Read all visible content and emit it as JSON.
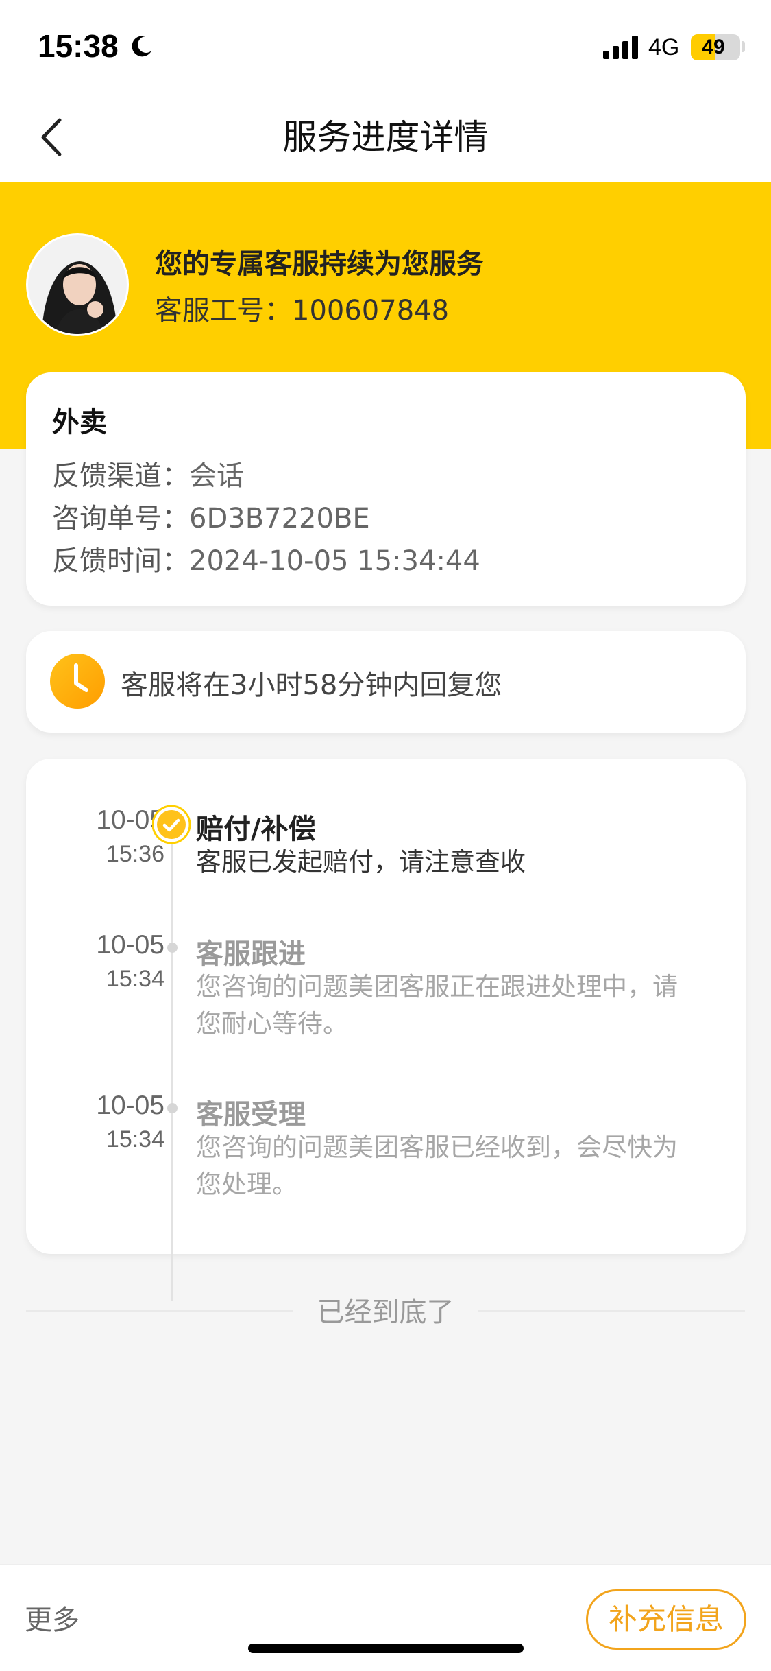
{
  "status_bar": {
    "time": "15:38",
    "network": "4G",
    "battery": "49",
    "battery_level": 0.49
  },
  "nav": {
    "title": "服务进度详情",
    "back_icon": "chevron-left-icon"
  },
  "agent": {
    "title": "您的专属客服持续为您服务",
    "id_label": "客服工号：100607848"
  },
  "info": {
    "title": "外卖",
    "rows": [
      {
        "label": "反馈渠道：",
        "value": "会话"
      },
      {
        "label": "咨询单号：",
        "value": "6D3B7220BE"
      },
      {
        "label": "反馈时间：",
        "value": "2024-10-05 15:34:44"
      }
    ]
  },
  "reply": {
    "text": "客服将在3小时58分钟内回复您",
    "icon": "clock-icon"
  },
  "timeline": [
    {
      "date": "10-05",
      "time": "15:36",
      "title": "赔付/补偿",
      "desc": "客服已发起赔付，请注意查收",
      "status": "done"
    },
    {
      "date": "10-05",
      "time": "15:34",
      "title": "客服跟进",
      "desc": "您咨询的问题美团客服正在跟进处理中，请您耐心等待。",
      "status": "past"
    },
    {
      "date": "10-05",
      "time": "15:34",
      "title": "客服受理",
      "desc": "您咨询的问题美团客服已经收到，会尽快为您处理。",
      "status": "past"
    }
  ],
  "end_text": "已经到底了",
  "bottom": {
    "more_label": "更多",
    "supplement_label": "补充信息"
  },
  "colors": {
    "brand_yellow": "#ffcf00",
    "accent_orange": "#f2a41c"
  }
}
